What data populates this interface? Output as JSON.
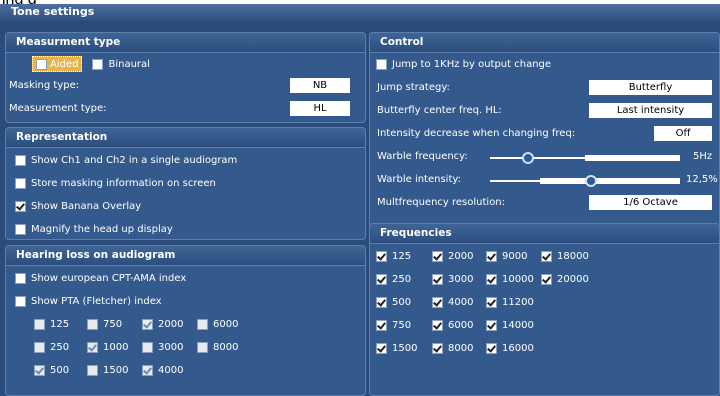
{
  "window_title": "Tone settings",
  "clipped_heading": "ing           g",
  "measurement_type": {
    "header": "Measurment type",
    "aided_label": "Aided",
    "binaural_label": "Binaural",
    "masking_type_label": "Masking type:",
    "masking_type_value": "NB",
    "measurement_type_label": "Measurement type:",
    "measurement_type_value": "HL"
  },
  "representation": {
    "header": "Representation",
    "items": [
      {
        "label": "Show Ch1 and Ch2 in a single audiogram",
        "checked": false
      },
      {
        "label": "Store masking information on screen",
        "checked": false
      },
      {
        "label": "Show Banana Overlay",
        "checked": true
      },
      {
        "label": "Magnify the head up display",
        "checked": false
      }
    ]
  },
  "hearing_loss": {
    "header": "Hearing loss on audiogram",
    "european_label": "Show european CPT-AMA index",
    "pta_label": "Show PTA (Fletcher) index",
    "freqs": [
      {
        "label": "125",
        "checked": false
      },
      {
        "label": "750",
        "checked": false
      },
      {
        "label": "2000",
        "checked": true
      },
      {
        "label": "6000",
        "checked": false
      },
      {
        "label": "250",
        "checked": false
      },
      {
        "label": "1000",
        "checked": true
      },
      {
        "label": "3000",
        "checked": false
      },
      {
        "label": "8000",
        "checked": false
      },
      {
        "label": "500",
        "checked": true
      },
      {
        "label": "1500",
        "checked": false
      },
      {
        "label": "4000",
        "checked": true
      }
    ]
  },
  "control": {
    "header": "Control",
    "jump_label": "Jump to 1KHz by output change",
    "jump_strategy_label": "Jump strategy:",
    "jump_strategy_value": "Butterfly",
    "butterfly_label": "Butterfly center freq. HL:",
    "butterfly_value": "Last intensity",
    "intensity_label": "Intensity decrease when changing freq:",
    "intensity_value": "Off",
    "warble_freq_label": "Warble frequency:",
    "warble_freq_value": "5Hz",
    "warble_freq_level": 0.2,
    "warble_int_label": "Warble intensity:",
    "warble_int_value": "12,5%",
    "warble_int_level": 0.53,
    "multifreq_label": "Multfrequency resolution:",
    "multifreq_value": "1/6 Octave"
  },
  "frequencies": {
    "header": "Frequencies",
    "items": [
      "125",
      "2000",
      "9000",
      "18000",
      "250",
      "3000",
      "10000",
      "20000",
      "500",
      "4000",
      "11200",
      "750",
      "6000",
      "14000",
      "1500",
      "8000",
      "16000"
    ]
  }
}
